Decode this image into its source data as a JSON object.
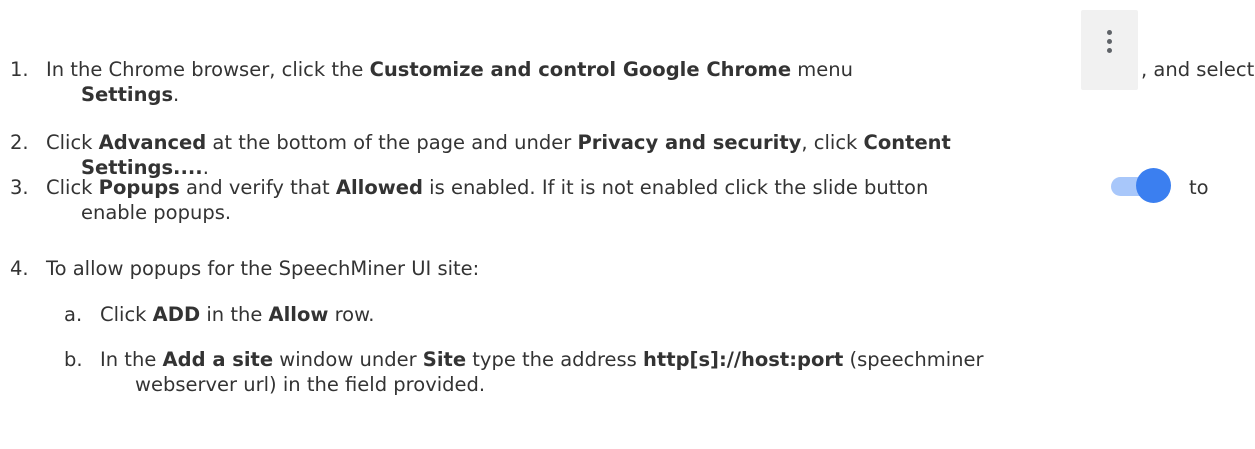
{
  "steps": [
    {
      "num": "1.",
      "line1": [
        "In the Chrome browser, click the ",
        "Customize and control Google Chrome",
        " menu ",
        ", and select"
      ],
      "line2": [
        "Settings",
        "."
      ]
    },
    {
      "num": "2.",
      "line1": [
        "Click ",
        "Advanced",
        " at the bottom of the page and under ",
        "Privacy and security",
        ", click ",
        "Content"
      ],
      "line2": [
        "Settings....",
        "."
      ]
    },
    {
      "num": "3.",
      "line1": [
        "Click ",
        "Popups",
        " and verify that ",
        "Allowed",
        " is enabled. If it is not enabled click the slide button ",
        "to"
      ],
      "line2": [
        "enable popups."
      ]
    },
    {
      "num": "4.",
      "line1": [
        "To allow popups for the SpeechMiner UI site:"
      ]
    }
  ],
  "substeps": [
    {
      "num": "a.",
      "line1": [
        "Click ",
        "ADD",
        " in the ",
        "Allow",
        " row."
      ]
    },
    {
      "num": "b.",
      "line1": [
        "In the ",
        "Add a site",
        " window under ",
        "Site",
        " type the address ",
        "http[s]://host:port",
        " (speechminer"
      ],
      "line2": [
        "webserver url) in the field provided."
      ]
    }
  ],
  "icons": {
    "menu": "vertical-three-dots-icon",
    "toggle": "toggle-switch-on-icon",
    "toggle_color": "#3b7ff0",
    "toggle_track_color": "#a8c7fa"
  }
}
